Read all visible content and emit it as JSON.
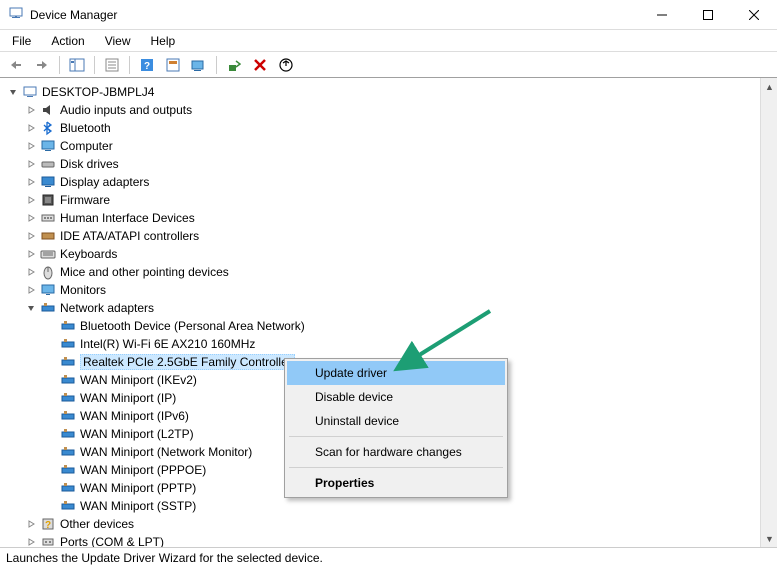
{
  "window": {
    "title": "Device Manager"
  },
  "menu": {
    "file": "File",
    "action": "Action",
    "view": "View",
    "help": "Help"
  },
  "tree": {
    "root": "DESKTOP-JBMPLJ4",
    "categories": {
      "audio": "Audio inputs and outputs",
      "bluetooth": "Bluetooth",
      "computer": "Computer",
      "disk": "Disk drives",
      "display": "Display adapters",
      "firmware": "Firmware",
      "hid": "Human Interface Devices",
      "ide": "IDE ATA/ATAPI controllers",
      "keyboards": "Keyboards",
      "mice": "Mice and other pointing devices",
      "monitors": "Monitors",
      "network": "Network adapters",
      "other": "Other devices",
      "ports": "Ports (COM & LPT)"
    },
    "network_items": {
      "bt": "Bluetooth Device (Personal Area Network)",
      "wifi": "Intel(R) Wi-Fi 6E AX210 160MHz",
      "realtek": "Realtek PCIe 2.5GbE Family Controller",
      "wan_ikev2": "WAN Miniport (IKEv2)",
      "wan_ip": "WAN Miniport (IP)",
      "wan_ipv6": "WAN Miniport (IPv6)",
      "wan_l2tp": "WAN Miniport (L2TP)",
      "wan_monitor": "WAN Miniport (Network Monitor)",
      "wan_pppoe": "WAN Miniport (PPPOE)",
      "wan_pptp": "WAN Miniport (PPTP)",
      "wan_sstp": "WAN Miniport (SSTP)"
    }
  },
  "context_menu": {
    "update": "Update driver",
    "disable": "Disable device",
    "uninstall": "Uninstall device",
    "scan": "Scan for hardware changes",
    "properties": "Properties"
  },
  "status": "Launches the Update Driver Wizard for the selected device."
}
